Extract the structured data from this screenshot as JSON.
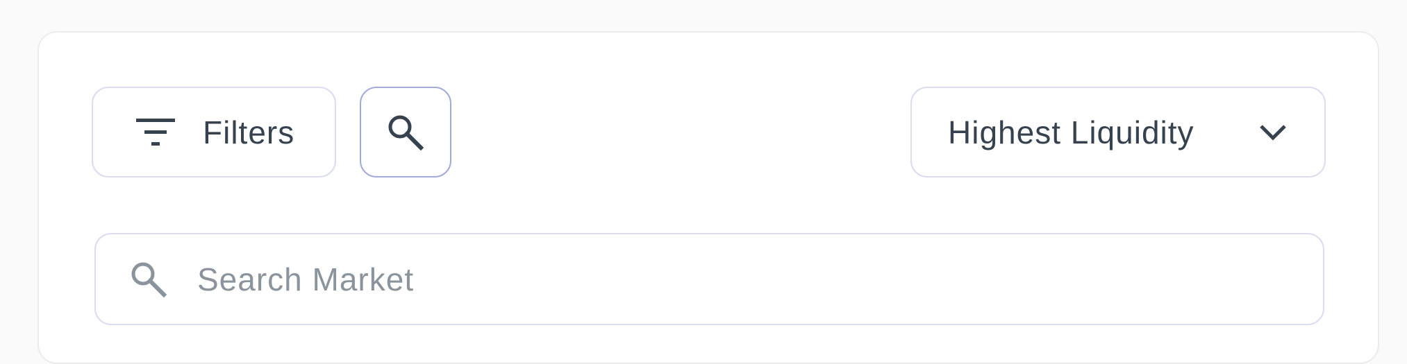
{
  "toolbar": {
    "filters_label": "Filters",
    "filters_icon": "filter-icon",
    "search_toggle_icon": "search-icon",
    "sort": {
      "selected": "Highest Liquidity",
      "icon": "chevron-down-icon"
    }
  },
  "search": {
    "placeholder": "Search Market",
    "value": "",
    "icon": "search-icon"
  },
  "colors": {
    "text": "#36424d",
    "placeholder": "#8b949c",
    "border": "#dcdcf0",
    "active_border": "#a4aad8"
  }
}
